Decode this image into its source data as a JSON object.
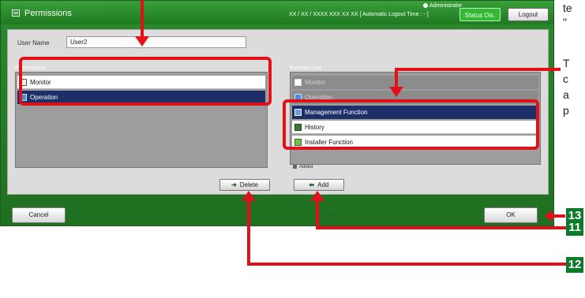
{
  "window": {
    "title": "Permissions",
    "admin_label": "Administrator",
    "datetime_text": "XX / XX / XXXX  XXX  XX  XX",
    "logout_timer_text": "[ Automatic Logout Time :  - ]",
    "status_button": "Status Dis.",
    "logout_button": "Logout"
  },
  "user": {
    "label": "User Name",
    "value": "User2"
  },
  "permissions": {
    "label": "Permissions",
    "items": [
      "Monitor",
      "Operation"
    ]
  },
  "function_list": {
    "label": "Function List",
    "items": [
      "Monitor",
      "Operation",
      "Management Function",
      "History",
      "Installer Function"
    ],
    "added_label": "Added"
  },
  "buttons": {
    "delete": "Delete",
    "add": "Add",
    "cancel": "Cancel",
    "ok": "OK"
  },
  "callouts": {
    "badges": [
      "13",
      "11",
      "12"
    ],
    "side_texts": [
      "te",
      "\"",
      "T",
      "c",
      "a",
      "p"
    ]
  },
  "colors": {
    "window_green": "#2b8a2c",
    "selection_blue": "#1c2f68",
    "callout_red": "#e0111a",
    "badge_green": "#0b7a2a"
  }
}
